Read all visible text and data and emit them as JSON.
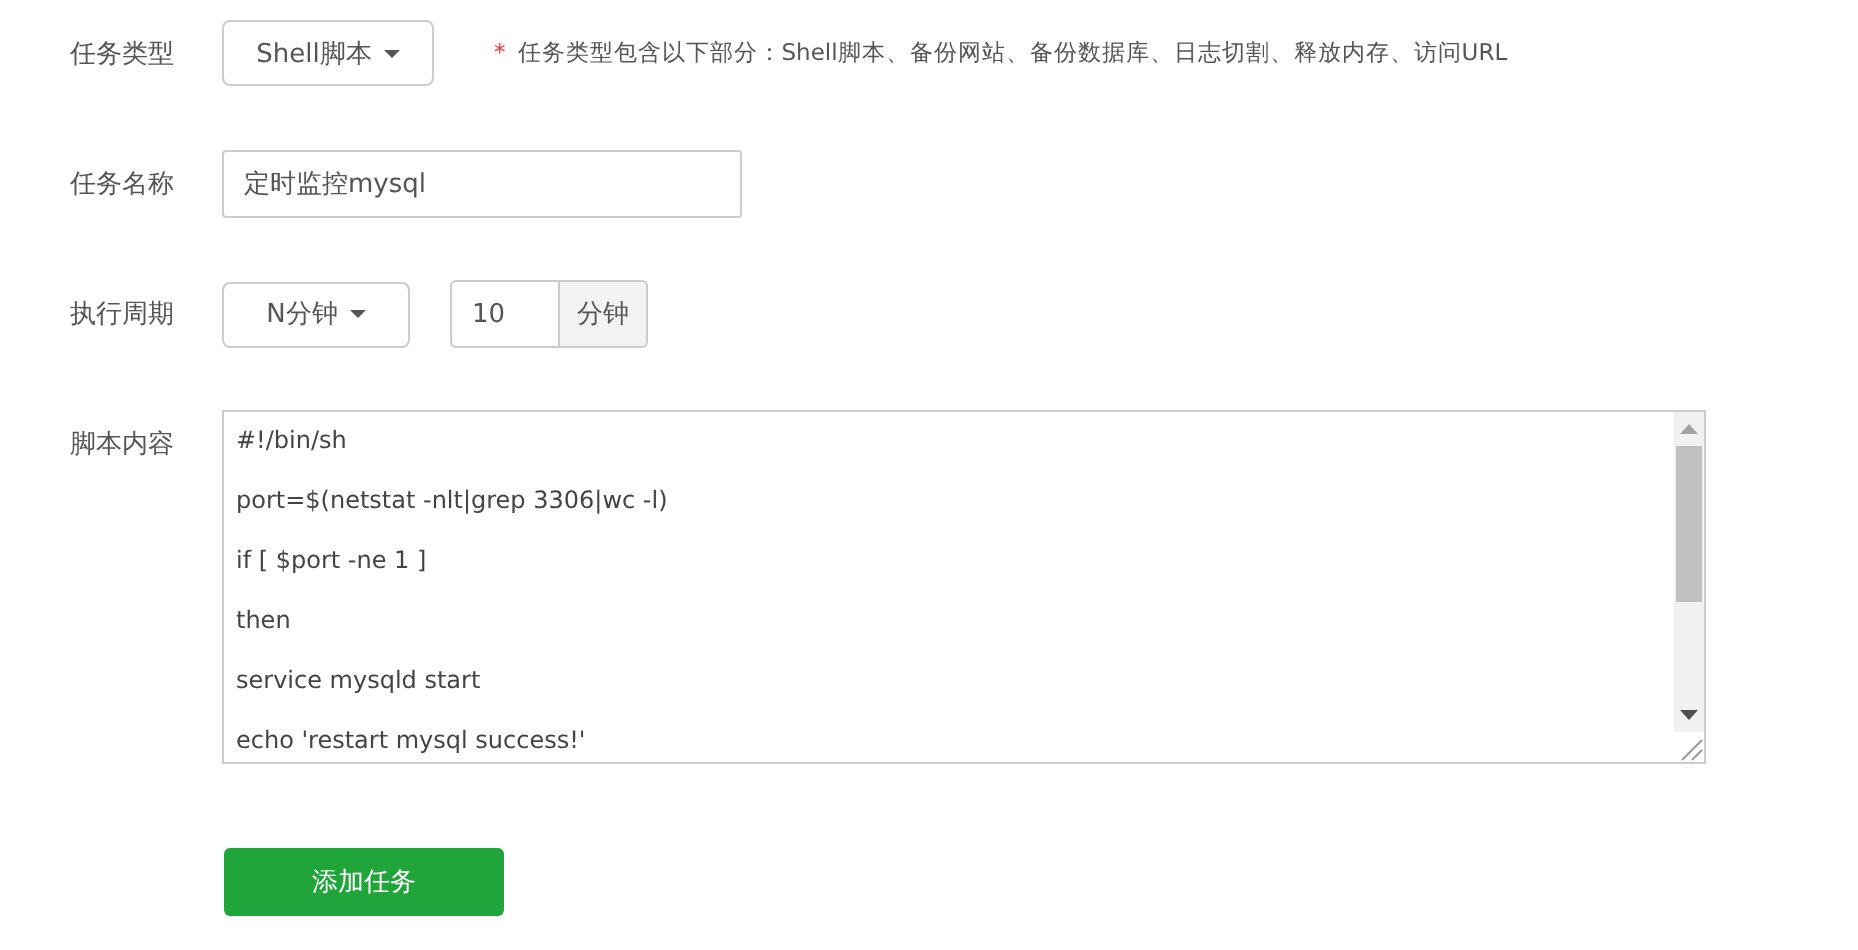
{
  "task_type": {
    "label": "任务类型",
    "value": "Shell脚本",
    "hint_mark": "*",
    "hint": "任务类型包含以下部分：Shell脚本、备份网站、备份数据库、日志切割、释放内存、访问URL"
  },
  "task_name": {
    "label": "任务名称",
    "value": "定时监控mysql"
  },
  "period": {
    "label": "执行周期",
    "unit_select": "N分钟",
    "value": "10",
    "unit": "分钟"
  },
  "script": {
    "label": "脚本内容",
    "lines": [
      "#!/bin/sh",
      "port=$(netstat -nlt|grep 3306|wc -l)",
      "if [ $port -ne 1 ]",
      "then",
      "service mysqld start",
      "echo 'restart mysql success!'"
    ]
  },
  "submit": "添加任务"
}
